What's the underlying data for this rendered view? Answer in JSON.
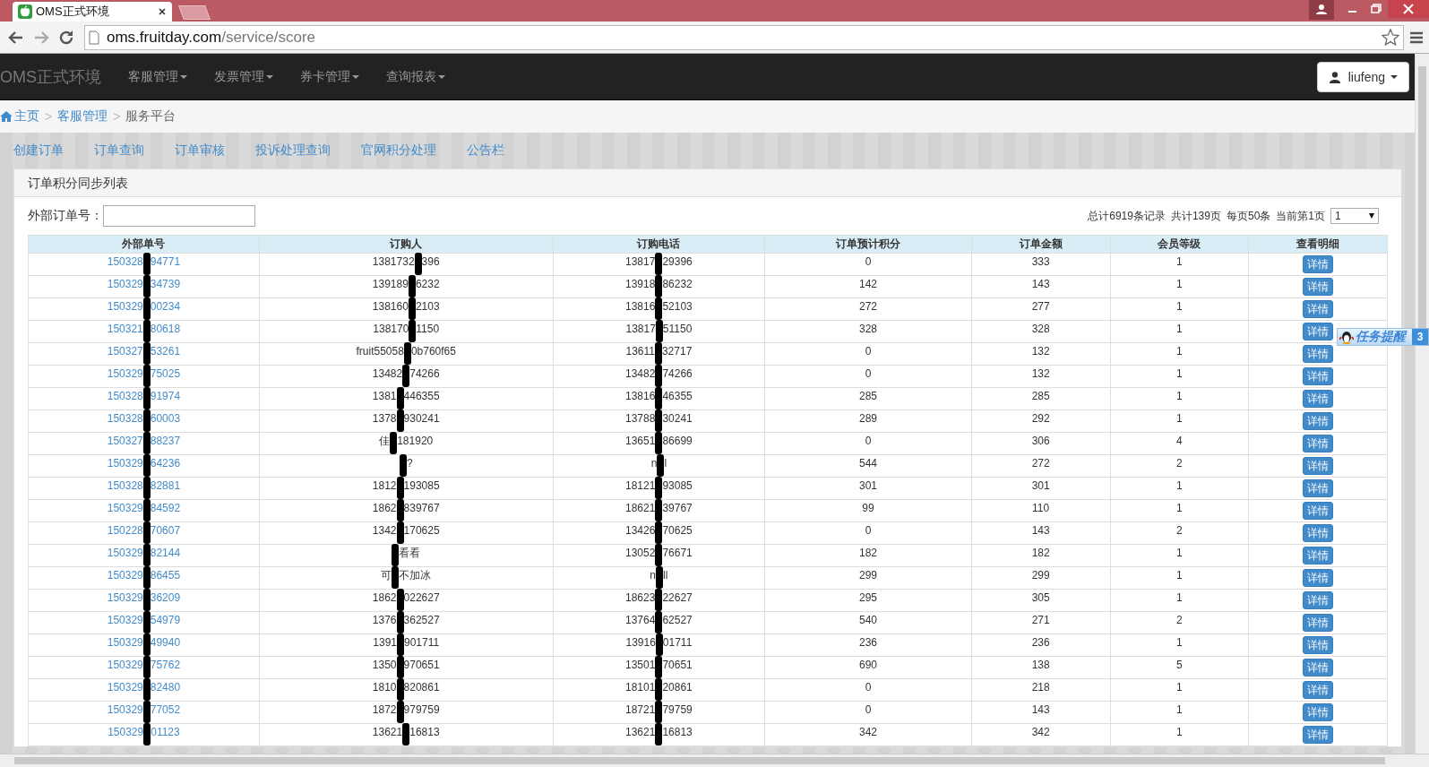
{
  "browser": {
    "tab_title": "OMS正式环境",
    "url_host": "oms.fruitday.com",
    "url_path": "/service/score"
  },
  "navbar": {
    "brand": "OMS正式环境",
    "menus": [
      "客服管理",
      "发票管理",
      "券卡管理",
      "查询报表"
    ],
    "user": "liufeng"
  },
  "breadcrumb": {
    "separator": ">",
    "items": [
      "主页",
      "客服管理",
      "服务平台"
    ]
  },
  "subnav": [
    "创建订单",
    "订单查询",
    "订单审核",
    "投诉处理查询",
    "官网积分处理",
    "公告栏"
  ],
  "panel": {
    "title": "订单积分同步列表",
    "filter_label": "外部订单号：",
    "pager": [
      "总计6919条记录",
      "共计139页",
      "每页50条",
      "当前第1页"
    ],
    "page_select": "1"
  },
  "table": {
    "columns": [
      "外部单号",
      "订购人",
      "订购电话",
      "订单预计积分",
      "订单金额",
      "会员等级",
      "查看明细"
    ],
    "rows": [
      {
        "order_no": {
          "a": "150328",
          "b": "94771"
        },
        "buyer": {
          "a": "1381732",
          "b": "396"
        },
        "phone": {
          "a": "13817",
          "b": "29396"
        },
        "points": "0",
        "amount": "333",
        "level": "1",
        "action": "详情"
      },
      {
        "order_no": {
          "a": "150329",
          "b": "34739"
        },
        "buyer": {
          "a": "139189",
          "b": "6232"
        },
        "phone": {
          "a": "13918",
          "b": "86232"
        },
        "points": "142",
        "amount": "143",
        "level": "1",
        "action": "详情"
      },
      {
        "order_no": {
          "a": "150329",
          "b": "00234"
        },
        "buyer": {
          "a": "138160",
          "b": "2103"
        },
        "phone": {
          "a": "13816",
          "b": "52103"
        },
        "points": "272",
        "amount": "277",
        "level": "1",
        "action": "详情"
      },
      {
        "order_no": {
          "a": "150321",
          "b": "80618"
        },
        "buyer": {
          "a": "138170",
          "b": "1150"
        },
        "phone": {
          "a": "13817",
          "b": "51150"
        },
        "points": "328",
        "amount": "328",
        "level": "1",
        "action": "详情"
      },
      {
        "order_no": {
          "a": "150327",
          "b": "53261"
        },
        "buyer": {
          "a": "fruit55058",
          "b": "0b760f65"
        },
        "phone": {
          "a": "13611",
          "b": "32717"
        },
        "points": "0",
        "amount": "132",
        "level": "1",
        "action": "详情"
      },
      {
        "order_no": {
          "a": "150329",
          "b": "75025"
        },
        "buyer": {
          "a": "13482",
          "b": "74266"
        },
        "phone": {
          "a": "13482",
          "b": "74266"
        },
        "points": "0",
        "amount": "132",
        "level": "1",
        "action": "详情"
      },
      {
        "order_no": {
          "a": "150328",
          "b": "91974"
        },
        "buyer": {
          "a": "1381",
          "b": "446355"
        },
        "phone": {
          "a": "13816",
          "b": "46355"
        },
        "points": "285",
        "amount": "285",
        "level": "1",
        "action": "详情"
      },
      {
        "order_no": {
          "a": "150328",
          "b": "60003"
        },
        "buyer": {
          "a": "1378",
          "b": "930241"
        },
        "phone": {
          "a": "13788",
          "b": "30241"
        },
        "points": "289",
        "amount": "292",
        "level": "1",
        "action": "详情"
      },
      {
        "order_no": {
          "a": "150327",
          "b": "88237"
        },
        "buyer": {
          "a": "佳",
          "b": "181920"
        },
        "phone": {
          "a": "13651",
          "b": "86699"
        },
        "points": "0",
        "amount": "306",
        "level": "4",
        "action": "详情"
      },
      {
        "order_no": {
          "a": "150329",
          "b": "64236"
        },
        "buyer": {
          "b": "?"
        },
        "phone": {
          "a": "n",
          "b": "l"
        },
        "points": "544",
        "amount": "272",
        "level": "2",
        "action": "详情"
      },
      {
        "order_no": {
          "a": "150328",
          "b": "82881"
        },
        "buyer": {
          "a": "1812",
          "b": "193085"
        },
        "phone": {
          "a": "18121",
          "b": "93085"
        },
        "points": "301",
        "amount": "301",
        "level": "1",
        "action": "详情"
      },
      {
        "order_no": {
          "a": "150329",
          "b": "84592"
        },
        "buyer": {
          "a": "1862",
          "b": "839767"
        },
        "phone": {
          "a": "18621",
          "b": "39767"
        },
        "points": "99",
        "amount": "110",
        "level": "1",
        "action": "详情"
      },
      {
        "order_no": {
          "a": "150228",
          "b": "70607"
        },
        "buyer": {
          "a": "1342",
          "b": "170625"
        },
        "phone": {
          "a": "13426",
          "b": "70625"
        },
        "points": "0",
        "amount": "143",
        "level": "2",
        "action": "详情"
      },
      {
        "order_no": {
          "a": "150329",
          "b": "82144"
        },
        "buyer": {
          "b": "看看"
        },
        "phone": {
          "a": "13052",
          "b": "76671"
        },
        "points": "182",
        "amount": "182",
        "level": "1",
        "action": "详情"
      },
      {
        "order_no": {
          "a": "150329",
          "b": "86455"
        },
        "buyer": {
          "a": "可",
          "b": "不加冰"
        },
        "phone": {
          "a": "n",
          "b": "ll"
        },
        "points": "299",
        "amount": "299",
        "level": "1",
        "action": "详情"
      },
      {
        "order_no": {
          "a": "150329",
          "b": "36209"
        },
        "buyer": {
          "a": "1862",
          "b": "022627"
        },
        "phone": {
          "a": "18623",
          "b": "22627"
        },
        "points": "295",
        "amount": "305",
        "level": "1",
        "action": "详情"
      },
      {
        "order_no": {
          "a": "150329",
          "b": "54979"
        },
        "buyer": {
          "a": "1376",
          "b": "362527"
        },
        "phone": {
          "a": "13764",
          "b": "62527"
        },
        "points": "540",
        "amount": "271",
        "level": "2",
        "action": "详情"
      },
      {
        "order_no": {
          "a": "150329",
          "b": "49940"
        },
        "buyer": {
          "a": "1391",
          "b": "901711"
        },
        "phone": {
          "a": "13916",
          "b": "01711"
        },
        "points": "236",
        "amount": "236",
        "level": "1",
        "action": "详情"
      },
      {
        "order_no": {
          "a": "150329",
          "b": "75762"
        },
        "buyer": {
          "a": "1350",
          "b": "970651"
        },
        "phone": {
          "a": "13501",
          "b": "70651"
        },
        "points": "690",
        "amount": "138",
        "level": "5",
        "action": "详情"
      },
      {
        "order_no": {
          "a": "150329",
          "b": "82480"
        },
        "buyer": {
          "a": "1810",
          "b": "820861"
        },
        "phone": {
          "a": "18101",
          "b": "20861"
        },
        "points": "0",
        "amount": "218",
        "level": "1",
        "action": "详情"
      },
      {
        "order_no": {
          "a": "150329",
          "b": "77052"
        },
        "buyer": {
          "a": "1872",
          "b": "979759"
        },
        "phone": {
          "a": "18721",
          "b": "79759"
        },
        "points": "0",
        "amount": "143",
        "level": "1",
        "action": "详情"
      },
      {
        "order_no": {
          "a": "150329",
          "b": "01123"
        },
        "buyer": {
          "a": "13621",
          "b": "16813"
        },
        "phone": {
          "a": "13621",
          "b": "16813"
        },
        "points": "342",
        "amount": "342",
        "level": "1",
        "action": "详情"
      }
    ]
  },
  "reminder": {
    "label": "任务提醒",
    "count": "3"
  }
}
